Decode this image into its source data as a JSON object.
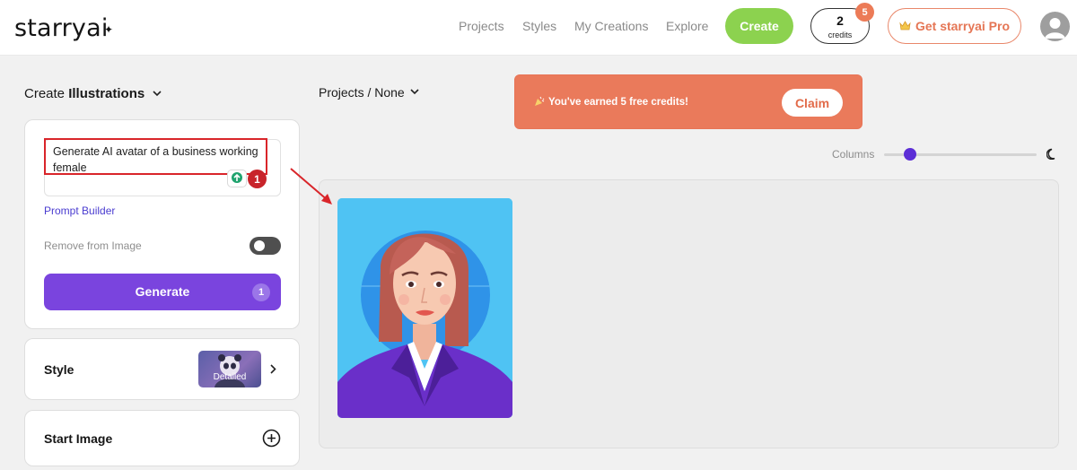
{
  "header": {
    "logo": "starryai",
    "nav": [
      "Projects",
      "Styles",
      "My Creations",
      "Explore"
    ],
    "create_label": "Create",
    "credits_count": "2",
    "credits_label": "credits",
    "credits_badge": "5",
    "pro_label": "Get starryai Pro"
  },
  "sidebar": {
    "mode_prefix": "Create ",
    "mode_value": "Illustrations",
    "prompt_text": "Generate AI avatar of a business working female",
    "step_badge": "1",
    "prompt_builder": "Prompt Builder",
    "remove_label": "Remove from Image",
    "generate_label": "Generate",
    "generate_cost": "1",
    "style_title": "Style",
    "style_value": "Detailed",
    "start_image_title": "Start Image"
  },
  "main": {
    "projects_label": "Projects / None",
    "banner_text": "You've earned 5 free credits!",
    "claim_label": "Claim",
    "columns_label": "Columns",
    "columns_value": 0.17
  },
  "colors": {
    "accent_purple": "#7a44de",
    "create_green": "#8cd24f",
    "banner_orange": "#ea7a5b",
    "annotation_red": "#d9252a"
  }
}
